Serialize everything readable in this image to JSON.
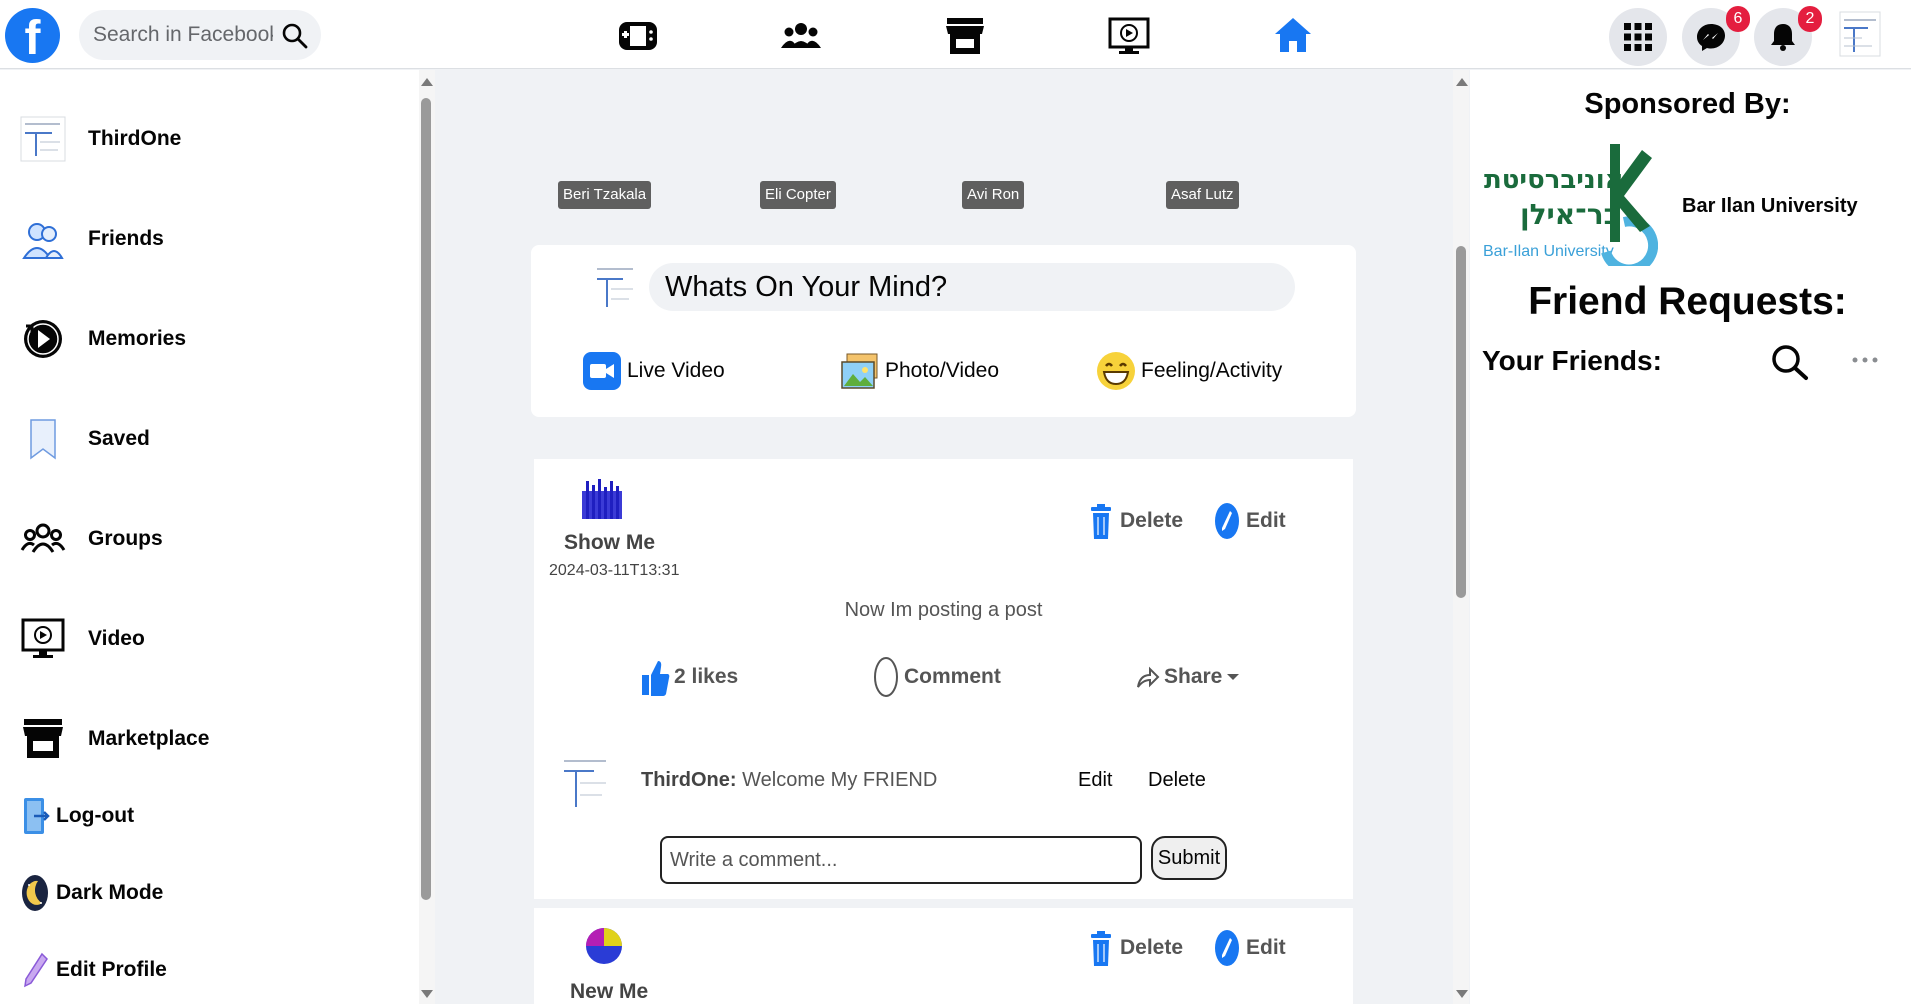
{
  "topbar": {
    "logo_letter": "f",
    "search_placeholder": "Search in Facebook",
    "messenger_badge": "6",
    "notifications_badge": "2"
  },
  "sidebar": {
    "items": [
      {
        "label": "ThirdOne"
      },
      {
        "label": "Friends"
      },
      {
        "label": "Memories"
      },
      {
        "label": "Saved"
      },
      {
        "label": "Groups"
      },
      {
        "label": "Video"
      },
      {
        "label": "Marketplace"
      },
      {
        "label": "Log-out"
      },
      {
        "label": "Dark Mode"
      },
      {
        "label": "Edit Profile"
      }
    ]
  },
  "stories": [
    "Beri Tzakala",
    "Eli Copter",
    "Avi Ron",
    "Asaf Lutz"
  ],
  "composer": {
    "placeholder": "Whats On Your Mind?",
    "live_video": "Live Video",
    "photo_video": "Photo/Video",
    "feeling": "Feeling/Activity"
  },
  "posts": [
    {
      "author": "Show Me",
      "date": "2024-03-11T13:31",
      "delete_label": "Delete",
      "edit_label": "Edit",
      "text": "Now Im posting a post",
      "likes": "2 likes",
      "comment_label": "Comment",
      "share_label": "Share",
      "comment": {
        "author": "ThirdOne:",
        "text": "Welcome My FRIEND",
        "edit": "Edit",
        "delete": "Delete"
      },
      "comment_placeholder": "Write a comment...",
      "submit_label": "Submit"
    },
    {
      "author": "New Me",
      "delete_label": "Delete",
      "edit_label": "Edit"
    }
  ],
  "rightbar": {
    "sponsored_title": "Sponsored By:",
    "sponsor_name": "Bar Ilan University",
    "sponsor_logo_hebrew_1": "אוניברסיטת",
    "sponsor_logo_hebrew_2": "בר־אילן",
    "sponsor_logo_english": "Bar-Ilan University",
    "friend_requests_title": "Friend Requests:",
    "your_friends_title": "Your Friends:"
  },
  "colors": {
    "brand_blue": "#1877f2",
    "badge_red": "#e41e3f",
    "background": "#f0f2f5"
  }
}
